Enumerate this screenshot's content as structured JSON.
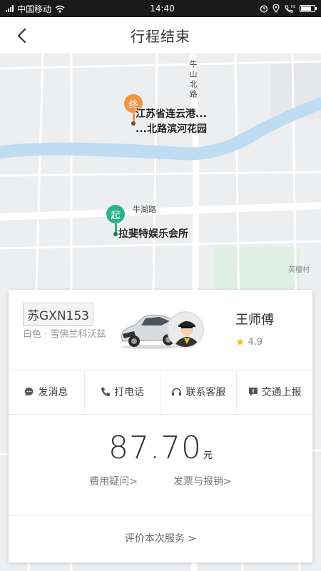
{
  "status_bar": {
    "carrier": "中国移动",
    "time": "14:40"
  },
  "header": {
    "title": "行程结束",
    "back_icon": "chevron-left-icon"
  },
  "map": {
    "roads": {
      "vertical_label": "牛山北路",
      "horizontal_label": "牛湖路",
      "corner_label": "英檀村"
    },
    "end_pin": {
      "badge": "终",
      "color": "#f39440",
      "place_line1": "江苏省连云港...",
      "place_line2": "...北路滨河花园"
    },
    "start_pin": {
      "badge": "起",
      "color": "#2bb28a",
      "place": "拉斐特娱乐会所"
    }
  },
  "trip_card": {
    "plate_number": "苏GXN153",
    "car_description": "白色 · 雪佛兰科沃兹",
    "driver_name": "王师傅",
    "rating": "4.9",
    "actions": [
      {
        "label": "发消息",
        "icon": "message-icon"
      },
      {
        "label": "打电话",
        "icon": "phone-icon"
      },
      {
        "label": "联系客服",
        "icon": "headset-icon"
      },
      {
        "label": "交通上报",
        "icon": "report-icon"
      }
    ],
    "fare": {
      "amount": "87.70",
      "unit": "元"
    },
    "fare_links": {
      "question": "费用疑问>",
      "invoice": "发票与报销>"
    },
    "review_link": "评价本次服务 >"
  }
}
